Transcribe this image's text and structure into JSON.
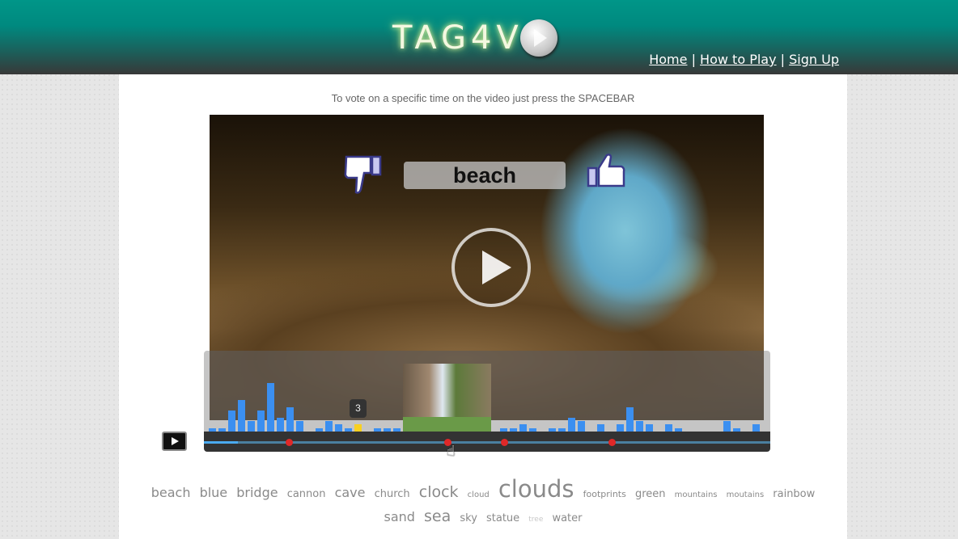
{
  "header": {
    "logo_text": "TAG4V",
    "nav": [
      {
        "label": "Home"
      },
      {
        "label": "How to Play"
      },
      {
        "label": "Sign Up"
      }
    ],
    "separator": "|"
  },
  "hint": "To vote on a specific time on the video just press the SPACEBAR",
  "video": {
    "current_tag": "beach",
    "tooltip_count": "3"
  },
  "timeline": {
    "progress_percent": 6,
    "marker_percents": [
      15,
      43,
      53,
      72
    ],
    "votes": [
      1,
      1,
      6,
      9,
      3,
      6,
      14,
      4,
      7,
      3,
      0,
      1,
      3,
      2,
      1,
      2,
      0,
      1,
      1,
      1,
      0,
      0,
      0,
      0,
      0,
      0,
      0,
      0,
      0,
      0,
      1,
      1,
      2,
      1,
      0,
      1,
      1,
      4,
      3,
      0,
      2,
      0,
      2,
      7,
      3,
      2,
      0,
      2,
      1,
      0,
      0,
      0,
      0,
      3,
      1,
      0,
      2
    ],
    "selected_index": 15,
    "colors": {
      "bar": "#3b8ff0",
      "selected": "#f8d020",
      "marker": "#e02828"
    }
  },
  "tag_cloud": [
    {
      "t": "beach",
      "s": 16
    },
    {
      "t": "blue",
      "s": 16
    },
    {
      "t": "bridge",
      "s": 16
    },
    {
      "t": "cannon",
      "s": 13
    },
    {
      "t": "cave",
      "s": 16
    },
    {
      "t": "church",
      "s": 13
    },
    {
      "t": "clock",
      "s": 19
    },
    {
      "t": "cloud",
      "s": 10
    },
    {
      "t": "clouds",
      "s": 29
    },
    {
      "t": "footprints",
      "s": 11
    },
    {
      "t": "green",
      "s": 13
    },
    {
      "t": "mountains",
      "s": 10
    },
    {
      "t": "moutains",
      "s": 10
    },
    {
      "t": "rainbow",
      "s": 13
    },
    {
      "t": "sand",
      "s": 16
    },
    {
      "t": "sea",
      "s": 19
    },
    {
      "t": "sky",
      "s": 13
    },
    {
      "t": "statue",
      "s": 13
    },
    {
      "t": "tree",
      "s": 9,
      "light": true
    },
    {
      "t": "water",
      "s": 13
    }
  ]
}
